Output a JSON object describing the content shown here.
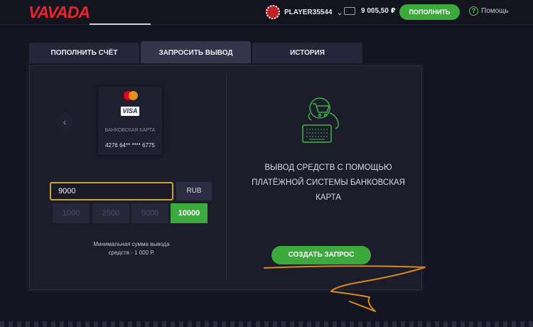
{
  "header": {
    "logo": "VAVADA",
    "username": "PLAYER35544",
    "balance": "9 005,50 ₽",
    "deposit_button": "ПОПОЛНИТЬ",
    "help": "Помощь"
  },
  "tabs": [
    {
      "label": "ПОПОЛНИТЬ СЧЁТ",
      "active": false
    },
    {
      "label": "ЗАПРОСИТЬ ВЫВОД",
      "active": true
    },
    {
      "label": "ИСТОРИЯ",
      "active": false
    }
  ],
  "card": {
    "type": "БАНКОВСКАЯ КАРТА",
    "number": "4276 64** **** 6775",
    "brand_text": "VISA"
  },
  "amount": {
    "value": "9000",
    "currency": "RUB",
    "presets": [
      "1000",
      "2500",
      "5000",
      "10000"
    ],
    "active_preset": "10000",
    "min_note_line1": "Минимальная сумма вывода",
    "min_note_line2": "средств - 1 000 Р."
  },
  "withdraw": {
    "title_line1": "ВЫВОД СРЕДСТВ С ПОМОЩЬЮ",
    "title_line2": "ПЛАТЁЖНОЙ СИСТЕМЫ БАНКОВСКАЯ",
    "title_line3": "КАРТА",
    "create_button": "СОЗДАТЬ ЗАПРОС"
  },
  "colors": {
    "accent_green": "#3ba93b",
    "brand_red": "#e8232b",
    "input_border": "#c9a43a",
    "annotation_orange": "#d98a1c"
  },
  "icons": [
    "avatar-icon",
    "chevron-down-icon",
    "wallet-icon",
    "help-icon",
    "chevron-left-icon",
    "mastercard-icon",
    "visa-icon",
    "cart-terminal-icon"
  ]
}
